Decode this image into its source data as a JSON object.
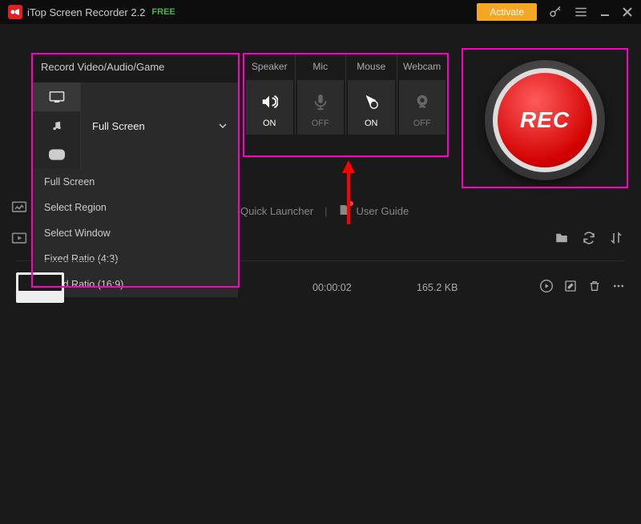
{
  "titlebar": {
    "app_name": "iTop Screen Recorder 2.2",
    "free_label": "FREE",
    "activate_label": "Activate"
  },
  "record_panel": {
    "title": "Record Video/Audio/Game",
    "selected_mode": "Full Screen",
    "dropdown": [
      "Full Screen",
      "Select Region",
      "Select Window",
      "Fixed Ratio (4:3)",
      "Fixed Ratio (16:9)"
    ]
  },
  "toggles": [
    {
      "label": "Speaker",
      "state": "ON",
      "on": true
    },
    {
      "label": "Mic",
      "state": "OFF",
      "on": false
    },
    {
      "label": "Mouse",
      "state": "ON",
      "on": true
    },
    {
      "label": "Webcam",
      "state": "OFF",
      "on": false
    }
  ],
  "rec_button": {
    "text": "REC"
  },
  "secondary": {
    "quick_launcher": "Quick Launcher",
    "user_guide": "User Guide"
  },
  "recording_row": {
    "duration": "00:00:02",
    "size": "165.2 KB"
  },
  "colors": {
    "highlight": "#ff00c8",
    "accent": "#f5a623",
    "rec_red": "#e02020"
  }
}
